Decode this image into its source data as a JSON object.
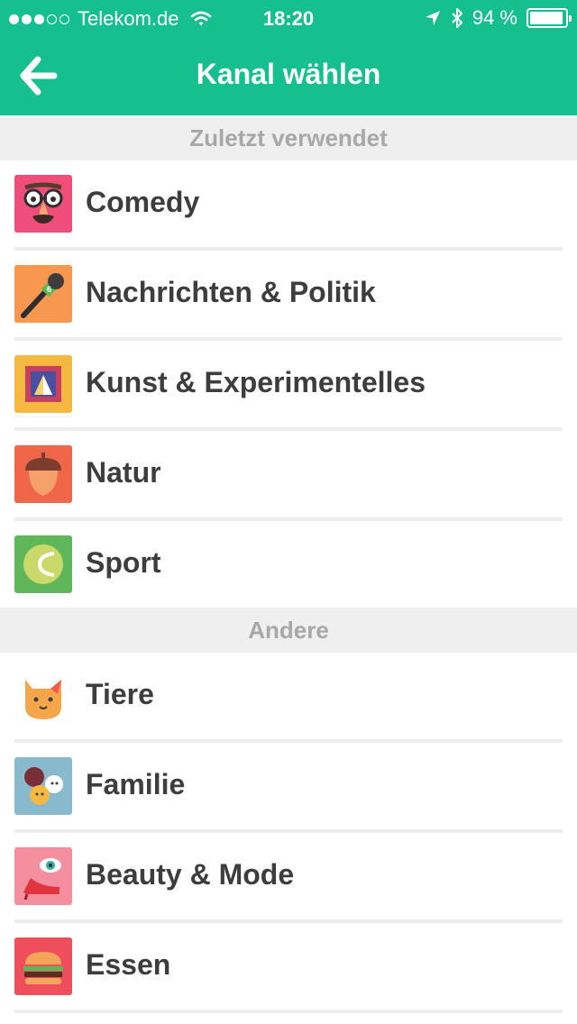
{
  "status_bar": {
    "carrier": "Telekom.de",
    "time": "18:20",
    "battery": "94 %",
    "battery_level": 0.94
  },
  "nav": {
    "title": "Kanal wählen",
    "back_icon": "arrow-left-icon"
  },
  "sections": {
    "recent": "Zuletzt verwendet",
    "other": "Andere"
  },
  "recent_items": [
    {
      "label": "Comedy",
      "icon": "comedy-glasses-icon",
      "color": "#ef4e7b"
    },
    {
      "label": "Nachrichten & Politik",
      "icon": "microphone-icon",
      "color": "#f8974f"
    },
    {
      "label": "Kunst & Experimentelles",
      "icon": "picture-frame-icon",
      "color": "#f5b840"
    },
    {
      "label": "Natur",
      "icon": "acorn-icon",
      "color": "#ef6748"
    },
    {
      "label": "Sport",
      "icon": "tennis-ball-icon",
      "color": "#5fb65b"
    }
  ],
  "other_items": [
    {
      "label": "Tiere",
      "icon": "cat-icon",
      "color": "#ffffff"
    },
    {
      "label": "Familie",
      "icon": "family-faces-icon",
      "color": "#88b9cd"
    },
    {
      "label": "Beauty & Mode",
      "icon": "high-heel-eye-icon",
      "color": "#f48fa0"
    },
    {
      "label": "Essen",
      "icon": "burger-icon",
      "color": "#ef4e5c"
    }
  ]
}
